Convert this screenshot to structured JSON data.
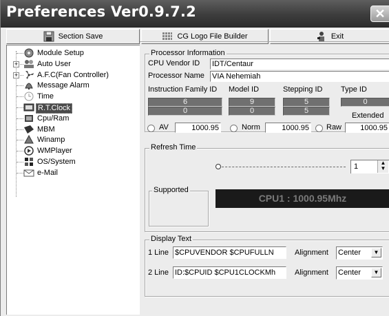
{
  "window": {
    "title": "Preferences Ver0.9.7.2",
    "close_glyph": "✕"
  },
  "toolbar": {
    "section_save_label": "Section Save",
    "logo_builder_label": "CG Logo File Builder",
    "exit_label": "Exit"
  },
  "tree": {
    "items": [
      {
        "label": "Module Setup",
        "icon": "module-setup-icon",
        "expandable": false,
        "selected": false
      },
      {
        "label": "Auto User",
        "icon": "users-icon",
        "expandable": true,
        "selected": false
      },
      {
        "label": "A.F.C(Fan Controller)",
        "icon": "fan-icon",
        "expandable": true,
        "selected": false
      },
      {
        "label": "Message Alarm",
        "icon": "alarm-icon",
        "expandable": false,
        "selected": false
      },
      {
        "label": "Time",
        "icon": "clock-icon",
        "expandable": false,
        "selected": false
      },
      {
        "label": "R.T.Clock",
        "icon": "rtclock-icon",
        "expandable": false,
        "selected": true
      },
      {
        "label": "Cpu/Ram",
        "icon": "chip-icon",
        "expandable": false,
        "selected": false
      },
      {
        "label": "MBM",
        "icon": "mbm-icon",
        "expandable": false,
        "selected": false
      },
      {
        "label": "Winamp",
        "icon": "winamp-icon",
        "expandable": false,
        "selected": false
      },
      {
        "label": "WMPlayer",
        "icon": "wmplayer-icon",
        "expandable": false,
        "selected": false
      },
      {
        "label": "OS/System",
        "icon": "os-icon",
        "expandable": false,
        "selected": false
      },
      {
        "label": "e-Mail",
        "icon": "email-icon",
        "expandable": false,
        "selected": false
      }
    ]
  },
  "processor": {
    "legend": "Processor Information",
    "vendor_label": "CPU Vendor ID",
    "vendor_value": "IDT/Centaur",
    "name_label": "Processor Name",
    "name_value": "VIA Nehemiah",
    "family_label": "Instruction Family ID",
    "model_label": "Model ID",
    "stepping_label": "Stepping ID",
    "type_label": "Type ID",
    "family_vals": [
      "6",
      "0"
    ],
    "model_vals": [
      "9",
      "0"
    ],
    "stepping_vals": [
      "5",
      "5"
    ],
    "type_val": "0",
    "type_text": "Extended",
    "av_label": "AV",
    "av_value": "1000.95",
    "norm_label": "Norm",
    "norm_value": "1000.95",
    "raw_label": "Raw",
    "raw_value": "1000.95"
  },
  "refresh": {
    "legend": "Refresh Time",
    "spin_value": "1",
    "slider_level": 0
  },
  "supported": {
    "legend": "Supported",
    "clock_text": "CPU1 : 1000.95Mhz"
  },
  "display_text": {
    "legend": "Display Text",
    "line1_label": "1 Line",
    "line1_value": "$CPUVENDOR $CPUFULLN",
    "line2_label": "2 Line",
    "line2_value": "ID:$CPUID $CPU1CLOCKMh",
    "alignment_label": "Alignment",
    "align1_value": "Center",
    "align2_value": "Center"
  }
}
